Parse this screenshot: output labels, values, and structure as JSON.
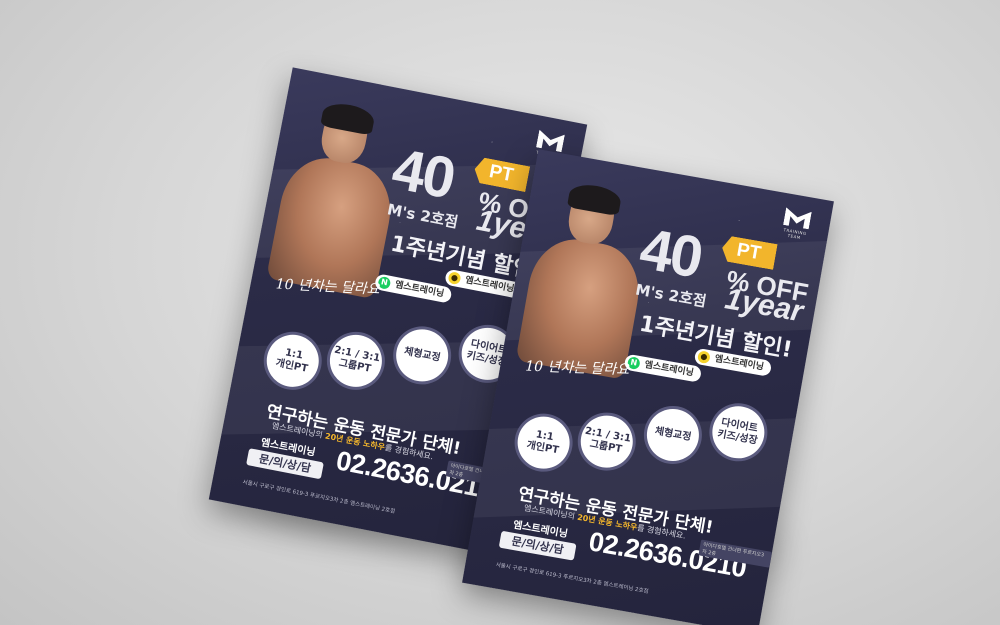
{
  "flyer": {
    "logo_text": "TRAINING TEAM",
    "discount": "40",
    "percent_off": "% OFF",
    "pt_tag": "PT",
    "branch": "M's 2호점",
    "one_year": "1year",
    "anniversary": "1주년기념  할인!",
    "naver_label": "엠스트레이닝",
    "kakao_label": "엠스트레이닝",
    "script_text": "10 년차는 달라요",
    "programs": [
      "1:1\n개인PT",
      "2:1 / 3:1\n그룹PT",
      "체형교정",
      "다이어트\n키즈/성장"
    ],
    "tagline": "연구하는 운동 전문가 단체!",
    "subline_pre": "엠스트레이닝의 ",
    "subline_highlight": "20년 운동 노하우",
    "subline_post": "를 경험하세요.",
    "inquiry_brand": "엠스트레이닝",
    "inquiry_label": "문/의/상/담",
    "phone": "02.2636.0210",
    "phone_note": "아이다호텔 건너편 푸르지오3차 2층",
    "address": "서울시 구로구 경인로 619-3 푸르지오3차 2층 엠스트레이닝 2호점"
  }
}
